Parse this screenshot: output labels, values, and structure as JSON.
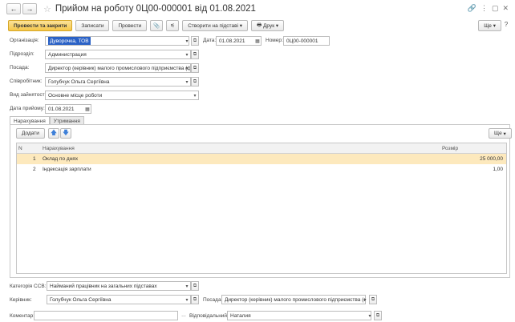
{
  "window": {
    "title": "Прийом на роботу 0Ц00-000001 від 01.08.2021",
    "controls": [
      "🔗",
      "⋮",
      "▢",
      "✕"
    ]
  },
  "toolbar": {
    "post_close_label": "Провести та закрити",
    "save_label": "Записати",
    "post_label": "Провести",
    "create_based_label": "Створити на підставі",
    "print_label": "Друк",
    "more_label": "Ще"
  },
  "form": {
    "organization_label": "Організація:",
    "organization_value": "Дуворочка, ТОВ",
    "date_label": "Дата:",
    "date_value": "01.08.2021",
    "number_label": "Номер:",
    "number_value": "0Ц00-000001",
    "division_label": "Підрозділ:",
    "division_value": "Администрация",
    "position_label": "Посада:",
    "position_value": "Директор (керівник) малого промислового підприємства (фірм...",
    "employee_label": "Співробітник:",
    "employee_value": "Голубчук Ольга Сергіївна",
    "employment_type_label": "Вид зайнятості:",
    "employment_type_value": "Основне місце роботи",
    "hire_date_label": "Дата прийому:",
    "hire_date_value": "01.08.2021"
  },
  "tabs": [
    "Нарахування",
    "Утримання"
  ],
  "accruals": {
    "add_label": "Додати",
    "more_label": "Ще",
    "columns": {
      "n": "N",
      "accrual": "Нарахування",
      "amount": "Розмір"
    },
    "rows": [
      {
        "n": "1",
        "accrual": "Оклад по днях",
        "amount": "25 000,00"
      },
      {
        "n": "2",
        "accrual": "Індексація зарплати",
        "amount": "1,00"
      }
    ]
  },
  "footer": {
    "ssv_label": "Категорія ССВ:",
    "ssv_value": "Найманий працівник на загальних підставах",
    "manager_label": "Керівник:",
    "manager_value": "Голубчук Ольга Сергіївна",
    "manager_position_label": "Посада:",
    "manager_position_value": "Директор (керівник) малого промислового підприємства (фірм...",
    "comment_label": "Коментар:",
    "comment_value": "",
    "responsible_label": "Відповідальний:",
    "responsible_value": "Наталия"
  }
}
